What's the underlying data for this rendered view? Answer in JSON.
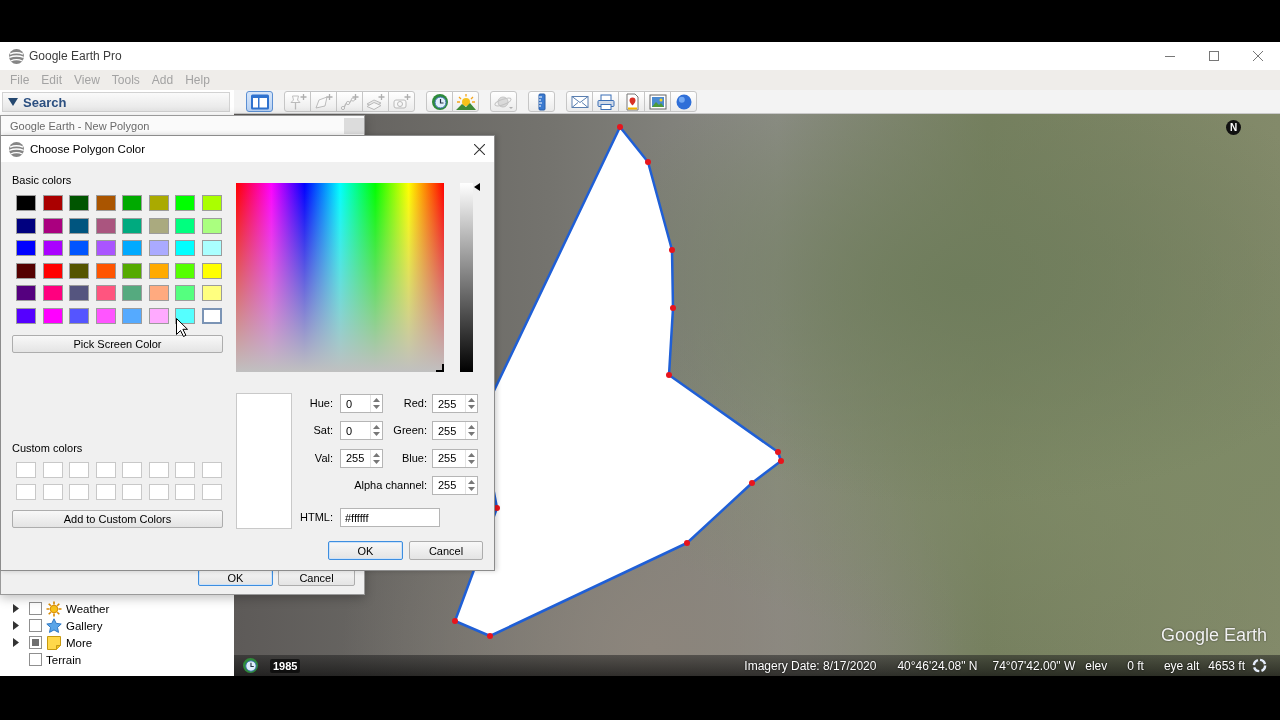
{
  "window": {
    "title": "Google Earth Pro"
  },
  "menu": [
    {
      "label": "File",
      "disabled": true
    },
    {
      "label": "Edit",
      "disabled": true
    },
    {
      "label": "View",
      "disabled": true
    },
    {
      "label": "Tools",
      "disabled": true
    },
    {
      "label": "Add",
      "disabled": true
    },
    {
      "label": "Help",
      "disabled": true
    }
  ],
  "search_panel": {
    "title": "Search",
    "expanded": true
  },
  "toolbar": {
    "groups": [
      {
        "buttons": [
          {
            "selected": true,
            "disabled": false
          }
        ]
      },
      {
        "buttons": [
          {
            "selected": false,
            "disabled": true
          },
          {
            "selected": false,
            "disabled": true
          },
          {
            "selected": false,
            "disabled": true
          },
          {
            "selected": false,
            "disabled": true
          },
          {
            "selected": false,
            "disabled": true
          }
        ]
      },
      {
        "buttons": [
          {
            "selected": false,
            "disabled": false
          },
          {
            "selected": false,
            "disabled": false
          }
        ]
      },
      {
        "buttons": [
          {
            "selected": false,
            "disabled": true
          }
        ]
      },
      {
        "buttons": [
          {
            "selected": false,
            "disabled": false
          }
        ]
      },
      {
        "buttons": [
          {
            "selected": false,
            "disabled": false
          },
          {
            "selected": false,
            "disabled": false
          },
          {
            "selected": false,
            "disabled": false
          },
          {
            "selected": false,
            "disabled": false
          },
          {
            "selected": false,
            "disabled": false
          }
        ]
      }
    ]
  },
  "map": {
    "compass": "N",
    "logo": "Google Earth",
    "status_bar": {
      "year": "1985",
      "imagery_date": "Imagery Date: 8/17/2020",
      "latitude": "40°46'24.08\" N",
      "longitude": "74°07'42.00\" W",
      "elevation_label": "elev",
      "elevation": "0 ft",
      "eye_alt_label": "eye alt",
      "eye_alt": "4653 ft"
    }
  },
  "layers": [
    {
      "label": "Weather",
      "expandable": true,
      "expanded": false,
      "checked": false,
      "partial": false
    },
    {
      "label": "Gallery",
      "expandable": true,
      "expanded": false,
      "checked": false,
      "partial": false
    },
    {
      "label": "More",
      "expandable": true,
      "expanded": false,
      "checked": false,
      "partial": true
    },
    {
      "label": "Terrain",
      "expandable": false,
      "expanded": false,
      "checked": false,
      "partial": false
    }
  ],
  "polygon_dialog": {
    "title": "Google Earth - New Polygon",
    "buttons": [
      {
        "label": "OK",
        "default": true
      },
      {
        "label": "Cancel",
        "default": false
      }
    ]
  },
  "color_dialog": {
    "title": "Choose Polygon Color",
    "basic_colors": {
      "label": "Basic colors",
      "swatches": [
        {
          "color": "#000000",
          "selected": false
        },
        {
          "color": "#aa0000",
          "selected": false
        },
        {
          "color": "#005500",
          "selected": false
        },
        {
          "color": "#aa5500",
          "selected": false
        },
        {
          "color": "#00aa00",
          "selected": false
        },
        {
          "color": "#aaaa00",
          "selected": false
        },
        {
          "color": "#00ff00",
          "selected": false
        },
        {
          "color": "#aaff00",
          "selected": false
        },
        {
          "color": "#00007f",
          "selected": false
        },
        {
          "color": "#aa007f",
          "selected": false
        },
        {
          "color": "#00557f",
          "selected": false
        },
        {
          "color": "#aa557f",
          "selected": false
        },
        {
          "color": "#00aa7f",
          "selected": false
        },
        {
          "color": "#aaaa7f",
          "selected": false
        },
        {
          "color": "#00ff7f",
          "selected": false
        },
        {
          "color": "#aaff7f",
          "selected": false
        },
        {
          "color": "#0000ff",
          "selected": false
        },
        {
          "color": "#aa00ff",
          "selected": false
        },
        {
          "color": "#0055ff",
          "selected": false
        },
        {
          "color": "#aa55ff",
          "selected": false
        },
        {
          "color": "#00aaff",
          "selected": false
        },
        {
          "color": "#aaaaff",
          "selected": false
        },
        {
          "color": "#00ffff",
          "selected": false
        },
        {
          "color": "#aaffff",
          "selected": false
        },
        {
          "color": "#550000",
          "selected": false
        },
        {
          "color": "#ff0000",
          "selected": false
        },
        {
          "color": "#555500",
          "selected": false
        },
        {
          "color": "#ff5500",
          "selected": false
        },
        {
          "color": "#55aa00",
          "selected": false
        },
        {
          "color": "#ffaa00",
          "selected": false
        },
        {
          "color": "#55ff00",
          "selected": false
        },
        {
          "color": "#ffff00",
          "selected": false
        },
        {
          "color": "#55007f",
          "selected": false
        },
        {
          "color": "#ff007f",
          "selected": false
        },
        {
          "color": "#55557f",
          "selected": false
        },
        {
          "color": "#ff557f",
          "selected": false
        },
        {
          "color": "#55aa7f",
          "selected": false
        },
        {
          "color": "#ffaa7f",
          "selected": false
        },
        {
          "color": "#55ff7f",
          "selected": false
        },
        {
          "color": "#ffff7f",
          "selected": false
        },
        {
          "color": "#5500ff",
          "selected": false
        },
        {
          "color": "#ff00ff",
          "selected": false
        },
        {
          "color": "#5555ff",
          "selected": false
        },
        {
          "color": "#ff55ff",
          "selected": false
        },
        {
          "color": "#55aaff",
          "selected": false
        },
        {
          "color": "#ffaaff",
          "selected": false
        },
        {
          "color": "#55ffff",
          "selected": false
        },
        {
          "color": "#ffffff",
          "selected": true
        }
      ]
    },
    "pick_screen_button": "Pick Screen Color",
    "custom_colors": {
      "label": "Custom colors",
      "slots": [
        {
          "color": "#ffffff"
        },
        {
          "color": "#ffffff"
        },
        {
          "color": "#ffffff"
        },
        {
          "color": "#ffffff"
        },
        {
          "color": "#ffffff"
        },
        {
          "color": "#ffffff"
        },
        {
          "color": "#ffffff"
        },
        {
          "color": "#ffffff"
        },
        {
          "color": "#ffffff"
        },
        {
          "color": "#ffffff"
        },
        {
          "color": "#ffffff"
        },
        {
          "color": "#ffffff"
        },
        {
          "color": "#ffffff"
        },
        {
          "color": "#ffffff"
        },
        {
          "color": "#ffffff"
        },
        {
          "color": "#ffffff"
        }
      ]
    },
    "add_custom_button": "Add to Custom Colors",
    "value_slider": {
      "level": 1
    },
    "spin_fields": [
      {
        "label": "Hue:",
        "value": "0"
      },
      {
        "label": "Red:",
        "value": "255"
      },
      {
        "label": "Sat:",
        "value": "0"
      },
      {
        "label": "Green:",
        "value": "255"
      },
      {
        "label": "Val:",
        "value": "255"
      },
      {
        "label": "Blue:",
        "value": "255"
      },
      {
        "label": "Alpha channel:",
        "value": "255"
      }
    ],
    "html_field": {
      "label": "HTML:",
      "value": "#ffffff"
    },
    "buttons": [
      {
        "label": "OK",
        "default": true
      },
      {
        "label": "Cancel",
        "default": false
      }
    ]
  }
}
